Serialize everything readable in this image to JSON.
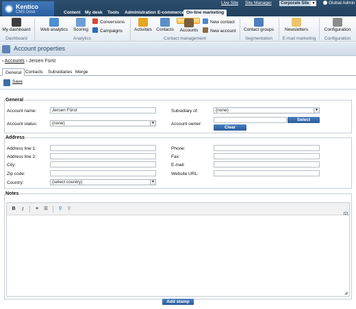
{
  "app": {
    "logo_title": "Kentico",
    "logo_subtitle": "CMS Desk"
  },
  "top_links": {
    "live_site": "Live Site",
    "site_manager": "Site Manager",
    "site_selector": "Corporate Site",
    "user": "Global Admin"
  },
  "main_tabs": [
    "Content",
    "My desk",
    "Tools",
    "Administration",
    "E-commerce",
    "On-line marketing"
  ],
  "ribbon": {
    "dashboard": {
      "button": "My dashboard",
      "group": "Dashboard"
    },
    "analytics": {
      "web_analytics": "Web analytics",
      "scoring": "Scoring",
      "conversions": "Conversions",
      "campaigns": "Campaigns",
      "group": "Analytics"
    },
    "contact_mgmt": {
      "activities": "Activities",
      "contacts": "Contacts",
      "accounts": "Accounts",
      "new_contact": "New contact",
      "new_account": "New account",
      "group": "Contact management"
    },
    "segmentation": {
      "contact_groups": "Contact groups",
      "group": "Segmentation"
    },
    "email": {
      "newsletters": "Newsletters",
      "group": "E-mail marketing"
    },
    "config": {
      "configuration": "Configuration",
      "group": "Configuration"
    }
  },
  "page_title": "Account properties",
  "breadcrumb": {
    "link": "Accounts",
    "current": "Jeroen Fürst"
  },
  "tabs": [
    "General",
    "Contacts",
    "Subsidiaries",
    "Merge"
  ],
  "toolbar": {
    "save": "Save"
  },
  "general": {
    "legend": "General",
    "account_name_label": "Account name:",
    "account_name_value": "Jeroen Fürst",
    "subsidiary_label": "Subsidiary of:",
    "subsidiary_value": "(none)",
    "status_label": "Account status:",
    "status_value": "(none)",
    "owner_label": "Account owner:",
    "select_button": "Select",
    "clear_button": "Clear"
  },
  "address": {
    "legend": "Address",
    "line1": "Address line 1:",
    "line2": "Address line 2:",
    "city": "City:",
    "zip": "Zip code:",
    "country": "Country:",
    "country_value": "(select country)",
    "phone": "Phone:",
    "fax": "Fax:",
    "email": "E-mail:",
    "website": "Website URL:"
  },
  "notes": {
    "legend": "Notes",
    "add_stamp": "Add stamp"
  }
}
